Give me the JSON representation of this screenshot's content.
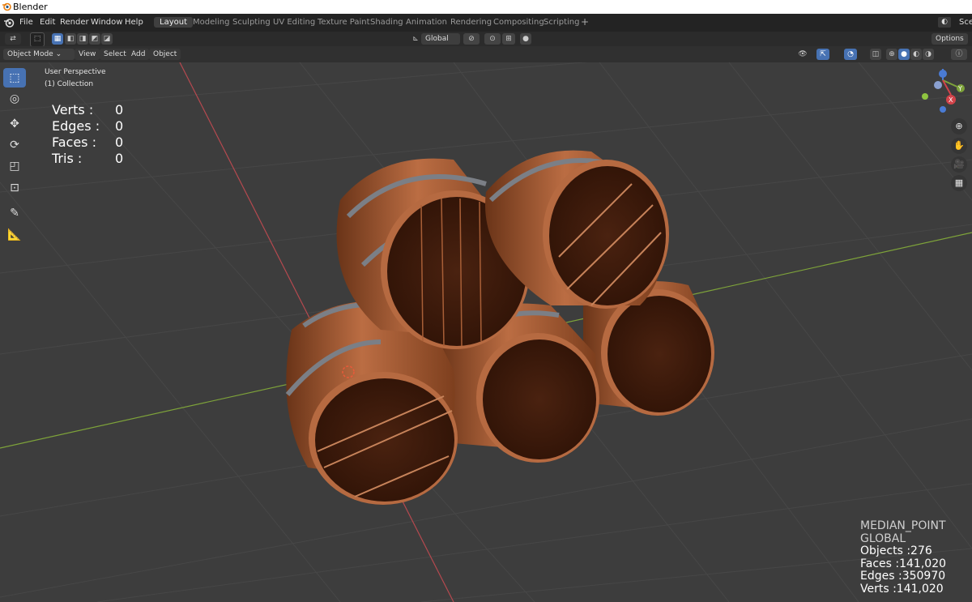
{
  "window": {
    "title": "Blender"
  },
  "menu": [
    "File",
    "Edit",
    "Render",
    "Window",
    "Help"
  ],
  "workspaces": [
    "Layout",
    "Modeling",
    "Sculpting",
    "UV Editing",
    "Texture Paint",
    "Shading",
    "Animation",
    "Rendering",
    "Compositing",
    "Scripting"
  ],
  "workspace_add": "+",
  "scene_label": "Scer",
  "header": {
    "orientation": "Global",
    "options": "Options"
  },
  "viewport_header": {
    "mode": "Object Mode",
    "menus": [
      "View",
      "Select",
      "Add",
      "Object"
    ]
  },
  "viewport": {
    "perspective": "User Perspective",
    "collection": "(1) Collection"
  },
  "stats": [
    {
      "label": "Verts :",
      "value": "0"
    },
    {
      "label": "Edges :",
      "value": "0"
    },
    {
      "label": "Faces :",
      "value": "0"
    },
    {
      "label": "Tris :",
      "value": "0"
    }
  ],
  "bottom_right": {
    "pivot": "MEDIAN_POINT",
    "orientation": "GLOBAL",
    "objects": "Objects :276",
    "faces": "Faces :141,020",
    "edges": "Edges :350970",
    "verts": "Verts :141,020"
  },
  "gizmo": {
    "x": "X",
    "y": "Y"
  },
  "colors": {
    "accent": "#4772b3",
    "wood": "#b5683f",
    "wood_dark": "#3d1a0a",
    "metal_band": "#7b7f86",
    "x_axis": "#b5494f",
    "y_axis": "#7ea33a"
  },
  "icons": [
    "blender-logo-icon",
    "select-box-icon",
    "cursor-icon",
    "move-icon",
    "rotate-icon",
    "scale-icon",
    "transform-icon",
    "annotate-icon",
    "measure-icon",
    "zoom-icon",
    "hand-pan-icon",
    "camera-icon",
    "grid-view-icon"
  ]
}
